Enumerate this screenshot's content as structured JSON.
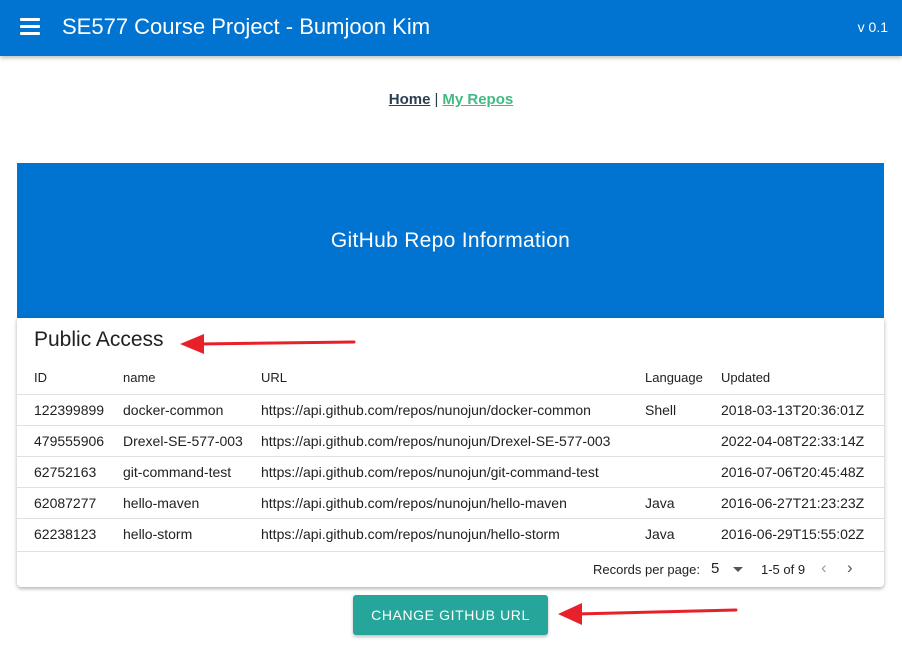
{
  "app": {
    "title": "SE577 Course Project - Bumjoon Kim",
    "version": "v 0.1"
  },
  "nav": {
    "home": "Home",
    "separator": "|",
    "repos": "My Repos"
  },
  "banner": {
    "title": "GitHub Repo Information"
  },
  "card": {
    "title": "Public Access"
  },
  "table": {
    "headers": [
      "ID",
      "name",
      "URL",
      "Language",
      "Updated"
    ],
    "rows": [
      [
        "122399899",
        "docker-common",
        "https://api.github.com/repos/nunojun/docker-common",
        "Shell",
        "2018-03-13T20:36:01Z"
      ],
      [
        "479555906",
        "Drexel-SE-577-003",
        "https://api.github.com/repos/nunojun/Drexel-SE-577-003",
        "",
        "2022-04-08T22:33:14Z"
      ],
      [
        "62752163",
        "git-command-test",
        "https://api.github.com/repos/nunojun/git-command-test",
        "",
        "2016-07-06T20:45:48Z"
      ],
      [
        "62087277",
        "hello-maven",
        "https://api.github.com/repos/nunojun/hello-maven",
        "Java",
        "2016-06-27T21:23:23Z"
      ],
      [
        "62238123",
        "hello-storm",
        "https://api.github.com/repos/nunojun/hello-storm",
        "Java",
        "2016-06-29T15:55:02Z"
      ]
    ]
  },
  "pagination": {
    "records_label": "Records per page:",
    "records_value": "5",
    "range": "1-5 of 9"
  },
  "button": {
    "change_label": "CHANGE GITHUB URL"
  },
  "colors": {
    "primary": "#0074d0",
    "teal": "#26a69a",
    "link_green": "#42b983",
    "annotation_red": "#e8202a"
  }
}
